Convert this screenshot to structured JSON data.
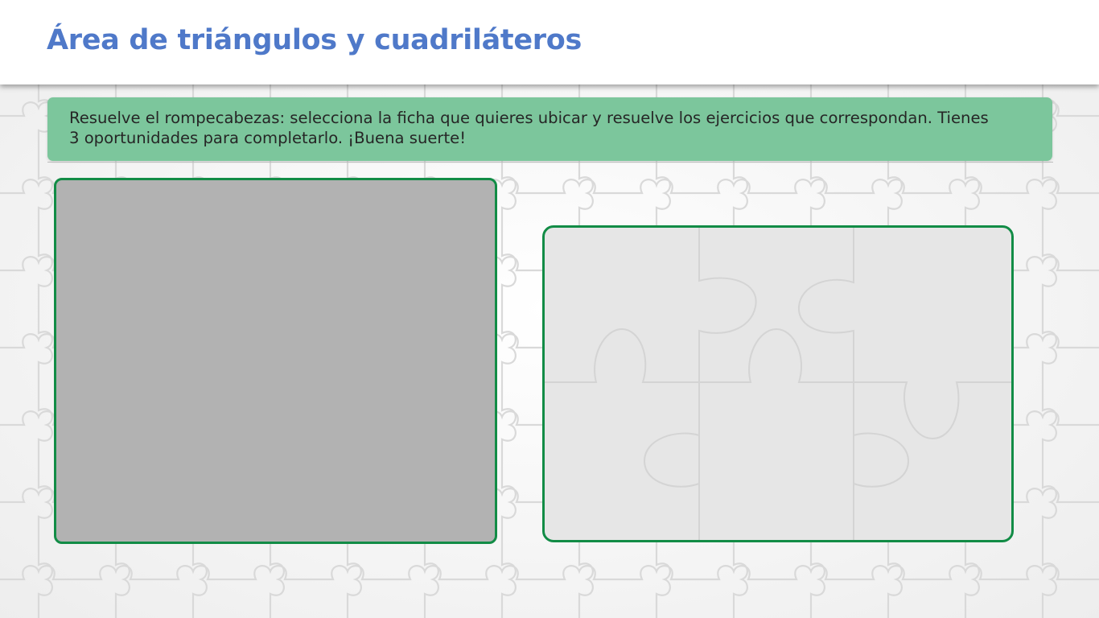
{
  "header": {
    "title": "Área de triángulos y cuadriláteros"
  },
  "instructions": {
    "text": "Resuelve el rompecabezas: selecciona la ficha que quieres ubicar y resuelve los ejercicios que correspondan. Tienes 3 oportunidades para completarlo. ¡Buena suerte!"
  },
  "puzzle": {
    "rows": 2,
    "columns": 3,
    "pieces": 6
  },
  "colors": {
    "title": "#4f79c9",
    "instruction_bar": "#7cc69c",
    "panel_border": "#128c46",
    "left_panel_fill": "#b2b2b2",
    "board_fill": "#e6e6e6"
  }
}
